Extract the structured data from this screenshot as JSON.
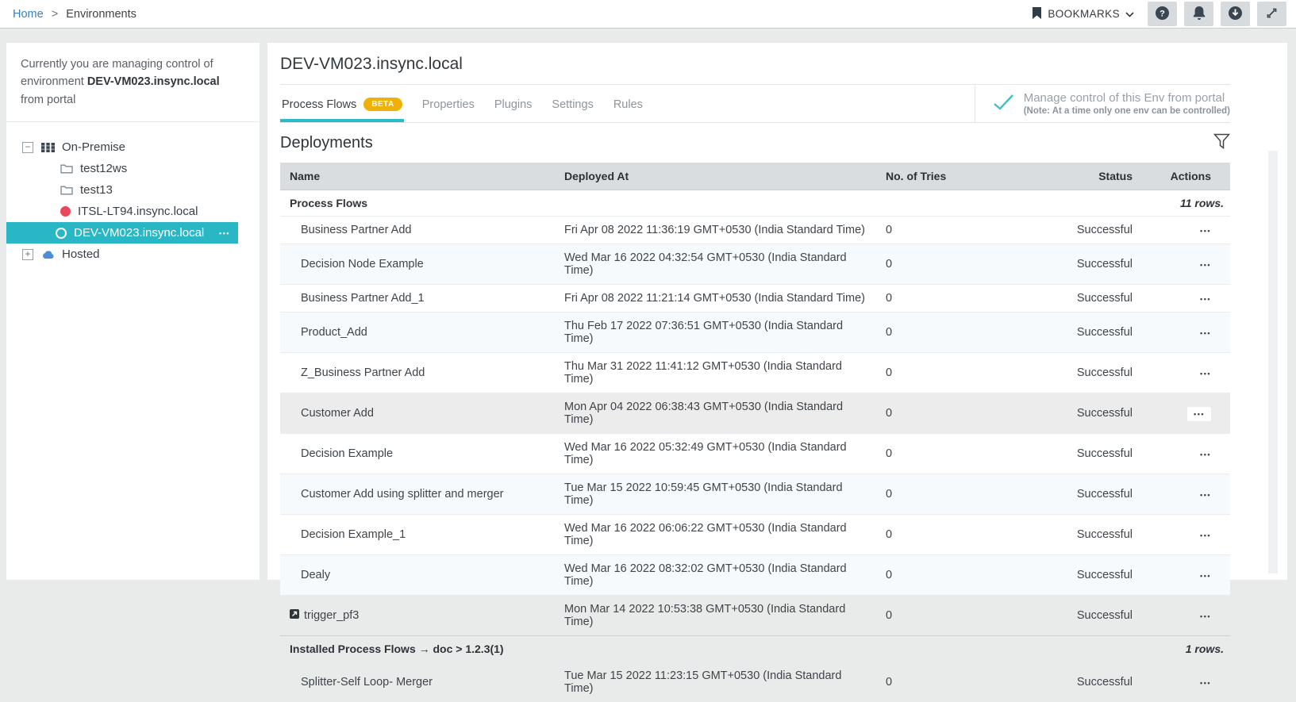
{
  "breadcrumb": {
    "home": "Home",
    "separator": ">",
    "current": "Environments"
  },
  "topbar": {
    "bookmarks_label": "BOOKMARKS",
    "buttons": [
      "help",
      "notifications",
      "download",
      "fullscreen"
    ]
  },
  "sidebar": {
    "info": {
      "prefix": "Currently you are managing control of environment",
      "env": "DEV-VM023.insync.local",
      "suffix": "from portal"
    },
    "tree": [
      {
        "expander": "−",
        "icon": "servers-icon",
        "label": "On-Premise"
      },
      {
        "icon": "folder-icon",
        "label": "test12ws"
      },
      {
        "icon": "folder-icon",
        "label": "test13"
      },
      {
        "icon": "red-dot-icon",
        "label": "ITSL-LT94.insync.local"
      },
      {
        "icon": "circle-outline-icon",
        "label": "DEV-VM023.insync.local",
        "selected": true,
        "menu_icon": "•••"
      },
      {
        "expander": "+",
        "icon": "cloud-icon",
        "label": "Hosted"
      }
    ]
  },
  "main": {
    "title": "DEV-VM023.insync.local",
    "tabs": [
      {
        "label": "Process Flows",
        "badge": "BETA",
        "active": true
      },
      {
        "label": "Properties"
      },
      {
        "label": "Plugins"
      },
      {
        "label": "Settings"
      },
      {
        "label": "Rules"
      }
    ],
    "manage_note": {
      "line1": "Manage control of this Env from portal",
      "line2": "(Note: At a time only one env can be controlled)"
    },
    "section_title": "Deployments",
    "table": {
      "columns": [
        "Name",
        "Deployed At",
        "No. of Tries",
        "Status",
        "Actions"
      ],
      "actions_icon": "•••",
      "groups": [
        {
          "label": "Process Flows",
          "count": "11 rows.",
          "rows": [
            {
              "name": "Business Partner Add",
              "deployed_at": "Fri Apr 08 2022 11:36:19 GMT+0530 (India Standard Time)",
              "tries": "0",
              "status": "Successful"
            },
            {
              "name": "Decision Node Example",
              "deployed_at": "Wed Mar 16 2022 04:32:54 GMT+0530 (India Standard Time)",
              "tries": "0",
              "status": "Successful"
            },
            {
              "name": "Business Partner Add_1",
              "deployed_at": "Fri Apr 08 2022 11:21:14 GMT+0530 (India Standard Time)",
              "tries": "0",
              "status": "Successful"
            },
            {
              "name": "Product_Add",
              "deployed_at": "Thu Feb 17 2022 07:36:51 GMT+0530 (India Standard Time)",
              "tries": "0",
              "status": "Successful"
            },
            {
              "name": "Z_Business Partner Add",
              "deployed_at": "Thu Mar 31 2022 11:41:12 GMT+0530 (India Standard Time)",
              "tries": "0",
              "status": "Successful"
            },
            {
              "name": "Customer Add",
              "deployed_at": "Mon Apr 04 2022 06:38:43 GMT+0530 (India Standard Time)",
              "tries": "0",
              "status": "Successful"
            },
            {
              "name": "Decision Example",
              "deployed_at": "Wed Mar 16 2022 05:32:49 GMT+0530 (India Standard Time)",
              "tries": "0",
              "status": "Successful"
            },
            {
              "name": "Customer Add using splitter and merger",
              "deployed_at": "Tue Mar 15 2022 10:59:45 GMT+0530 (India Standard Time)",
              "tries": "0",
              "status": "Successful"
            },
            {
              "name": "Decision Example_1",
              "deployed_at": "Wed Mar 16 2022 06:06:22 GMT+0530 (India Standard Time)",
              "tries": "0",
              "status": "Successful"
            },
            {
              "name": "Dealy",
              "deployed_at": "Wed Mar 16 2022 08:32:02 GMT+0530 (India Standard Time)",
              "tries": "0",
              "status": "Successful"
            },
            {
              "name": "trigger_pf3",
              "deployed_at": "Mon Mar 14 2022 10:53:38 GMT+0530 (India Standard Time)",
              "tries": "0",
              "status": "Successful",
              "icon": "external-link-icon"
            }
          ]
        },
        {
          "label": "Installed Process Flows → doc > 1.2.3(1)",
          "count": "1 rows.",
          "rows": [
            {
              "name": "Splitter-Self Loop- Merger",
              "deployed_at": "Tue Mar 15 2022 11:23:15 GMT+0530 (India Standard Time)",
              "tries": "0",
              "status": "Successful"
            }
          ]
        }
      ]
    }
  },
  "colors": {
    "accent_teal": "#29b6c5",
    "beta_yellow": "#eeb009",
    "link_blue": "#3c7ec0",
    "offline_red": "#e8485a",
    "hosted_blue": "#4d8fd4",
    "table_header_gray": "#d9dde0"
  }
}
